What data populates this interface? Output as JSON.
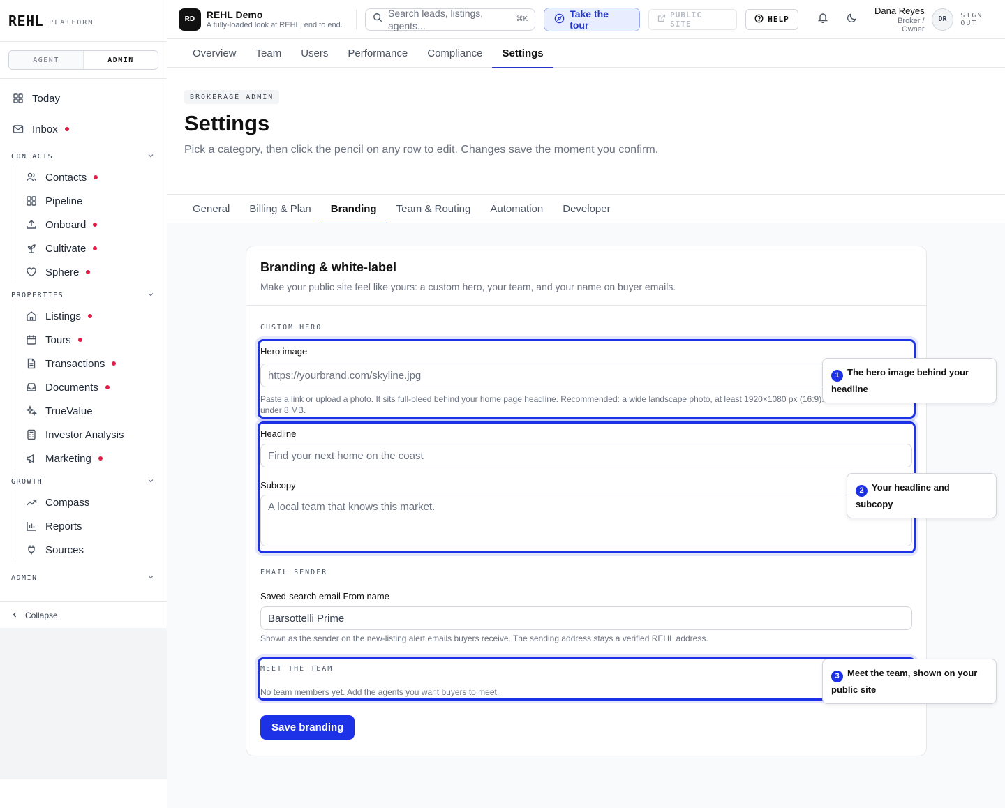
{
  "brand": {
    "logo": "REHL",
    "sub": "PLATFORM"
  },
  "mode_toggle": {
    "agent": "AGENT",
    "admin": "ADMIN"
  },
  "sidebar": {
    "today": "Today",
    "inbox": "Inbox",
    "sections": {
      "contacts": "CONTACTS",
      "properties": "PROPERTIES",
      "growth": "GROWTH",
      "admin": "ADMIN"
    },
    "contacts_items": [
      "Contacts",
      "Pipeline",
      "Onboard",
      "Cultivate",
      "Sphere"
    ],
    "properties_items": [
      "Listings",
      "Tours",
      "Transactions",
      "Documents",
      "TrueValue",
      "Investor Analysis",
      "Marketing"
    ],
    "growth_items": [
      "Compass",
      "Reports",
      "Sources"
    ],
    "collapse": "Collapse"
  },
  "header": {
    "workspace_initials": "RD",
    "workspace_title": "REHL Demo",
    "workspace_subtitle": "A fully-loaded look at REHL, end to end.",
    "search_placeholder": "Search leads, listings, agents...",
    "search_shortcut": "⌘K",
    "tour_label": "Take the tour",
    "public_site_label": "PUBLIC SITE",
    "help_label": "HELP",
    "user_name": "Dana Reyes",
    "user_role": "Broker / Owner",
    "user_initials": "DR",
    "sign_out": "SIGN OUT"
  },
  "top_tabs": [
    "Overview",
    "Team",
    "Users",
    "Performance",
    "Compliance",
    "Settings"
  ],
  "page": {
    "eyebrow": "BROKERAGE ADMIN",
    "title": "Settings",
    "description": "Pick a category, then click the pencil on any row to edit. Changes save the moment you confirm."
  },
  "settings_tabs": [
    "General",
    "Billing & Plan",
    "Branding",
    "Team & Routing",
    "Automation",
    "Developer"
  ],
  "card": {
    "title": "Branding & white-label",
    "description": "Make your public site feel like yours: a custom hero, your team, and your name on buyer emails.",
    "custom_hero_label": "CUSTOM HERO",
    "hero_image_label": "Hero image",
    "hero_image_placeholder": "https://yourbrand.com/skyline.jpg",
    "hero_image_hint": "Paste a link or upload a photo. It sits full-bleed behind your home page headline. Recommended: a wide landscape photo, at least 1920×1080 px (16:9). JPG, PNG, or WebP, under 8 MB.",
    "headline_label": "Headline",
    "headline_placeholder": "Find your next home on the coast",
    "subcopy_label": "Subcopy",
    "subcopy_placeholder": "A local team that knows this market.",
    "email_sender_label": "EMAIL SENDER",
    "from_name_label": "Saved-search email From name",
    "from_name_value": "Barsottelli Prime",
    "from_name_hint": "Shown as the sender on the new-listing alert emails buyers receive. The sending address stays a verified REHL address.",
    "meet_team_label": "MEET THE TEAM",
    "meet_team_empty": "No team members yet. Add the agents you want buyers to meet.",
    "save_label": "Save branding"
  },
  "tour_tips": [
    {
      "num": "1",
      "text": "The hero image behind your headline"
    },
    {
      "num": "2",
      "text": "Your headline and subcopy"
    },
    {
      "num": "3",
      "text": "Meet the team, shown on your public site"
    }
  ],
  "colors": {
    "accent": "#1d32e6",
    "notify_dot": "#e11d48"
  }
}
